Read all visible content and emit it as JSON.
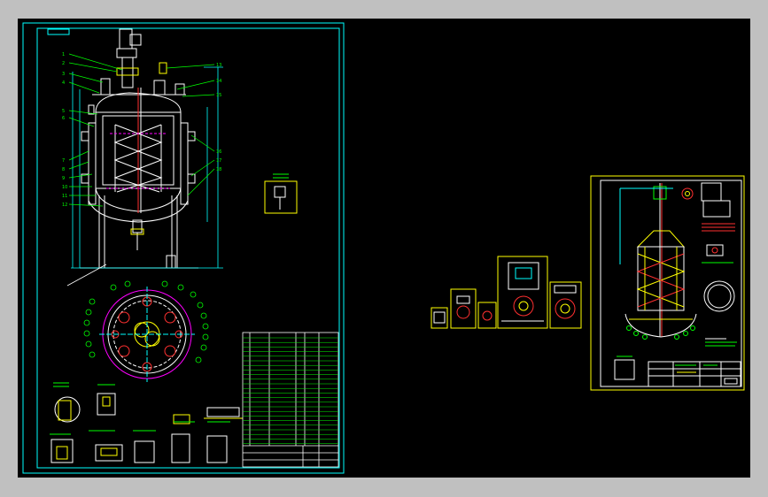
{
  "app": {
    "title": ""
  },
  "drawing": {
    "left_sheet_tag": "",
    "colors": {
      "background": "#000000",
      "frame": "#00ffff",
      "outline": "#ffffff",
      "callout": "#00ff00",
      "highlight": "#ffff00",
      "accent": "#ff00ff",
      "danger": "#ff3030"
    },
    "callouts": [
      "1",
      "2",
      "3",
      "4",
      "5",
      "6",
      "7",
      "8",
      "9",
      "10",
      "11",
      "12",
      "13",
      "14",
      "15",
      "16",
      "17",
      "18"
    ]
  }
}
